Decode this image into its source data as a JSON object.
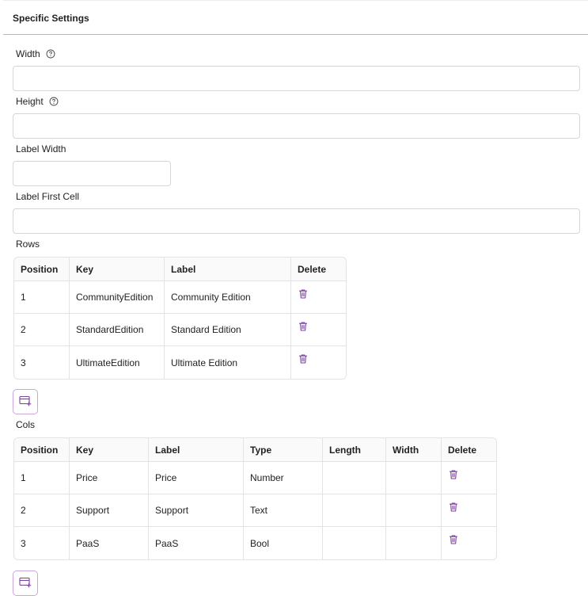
{
  "section": {
    "title": "Specific Settings"
  },
  "fields": {
    "width": {
      "label": "Width",
      "value": ""
    },
    "height": {
      "label": "Height",
      "value": ""
    },
    "label_width": {
      "label": "Label Width",
      "value": ""
    },
    "label_first_cell": {
      "label": "Label First Cell",
      "value": ""
    }
  },
  "rows": {
    "label": "Rows",
    "headers": {
      "position": "Position",
      "key": "Key",
      "label": "Label",
      "delete": "Delete"
    },
    "items": [
      {
        "position": "1",
        "key": "CommunityEdition",
        "label": "Community Edition"
      },
      {
        "position": "2",
        "key": "StandardEdition",
        "label": "Standard Edition"
      },
      {
        "position": "3",
        "key": "UltimateEdition",
        "label": "Ultimate Edition"
      }
    ]
  },
  "cols": {
    "label": "Cols",
    "headers": {
      "position": "Position",
      "key": "Key",
      "label": "Label",
      "type": "Type",
      "length": "Length",
      "width": "Width",
      "delete": "Delete"
    },
    "items": [
      {
        "position": "1",
        "key": "Price",
        "label": "Price",
        "type": "Number",
        "length": "",
        "width": ""
      },
      {
        "position": "2",
        "key": "Support",
        "label": "Support",
        "type": "Text",
        "length": "",
        "width": ""
      },
      {
        "position": "3",
        "key": "PaaS",
        "label": "PaaS",
        "type": "Bool",
        "length": "",
        "width": ""
      }
    ]
  },
  "icons": {
    "help": "help-circle-icon",
    "delete": "trash-icon",
    "add": "add-row-icon"
  },
  "colors": {
    "accent": "#7b3fa3",
    "divider": "#c9a6dc"
  }
}
